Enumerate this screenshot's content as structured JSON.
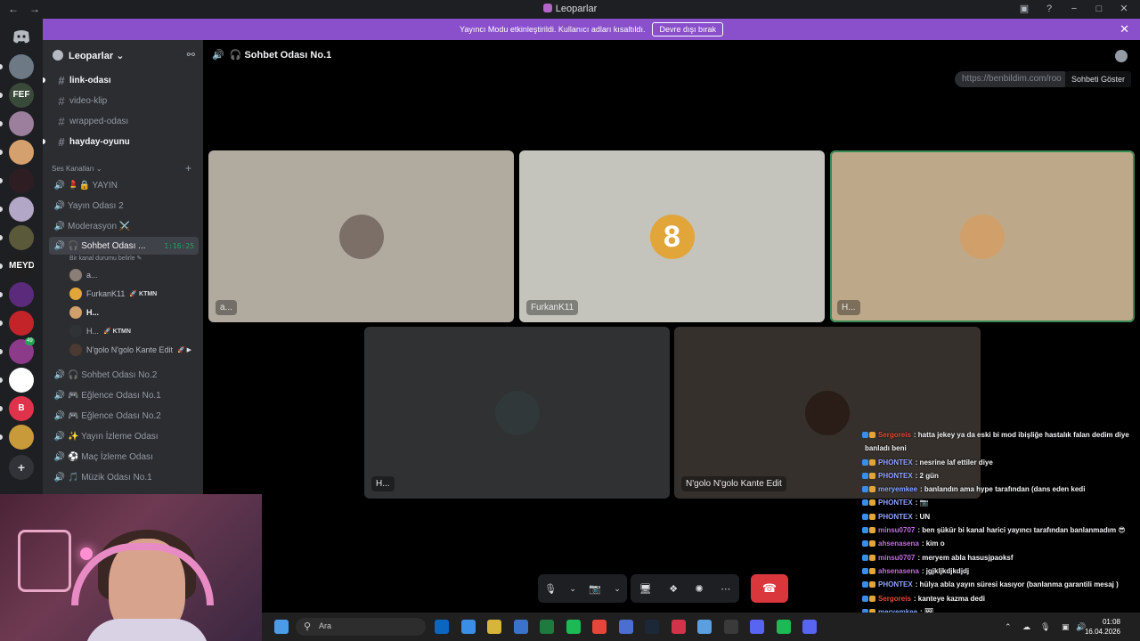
{
  "window": {
    "title": "Leoparlar",
    "controls": [
      "−",
      "□",
      "✕"
    ],
    "left_icons": [
      "←",
      "→"
    ]
  },
  "banner": {
    "message": "Yayıncı Modu etkinleştirildi. Kullanıcı adları kısaltıldı.",
    "button": "Devre dışı bırak",
    "color": "#8a4fcb"
  },
  "servers": [
    {
      "icon": "discord-home-icon",
      "label": ""
    },
    {
      "label": "",
      "color": "#6d7a86"
    },
    {
      "label": "FEF",
      "color": "#3a4a3a"
    },
    {
      "label": "",
      "color": "#9b7f9c"
    },
    {
      "label": "",
      "color": "#d4a16e"
    },
    {
      "label": "",
      "color": "#2e1e24"
    },
    {
      "label": "",
      "color": "#b3a7c8"
    },
    {
      "label": "",
      "color": "#5a5a3a"
    },
    {
      "label": "MEYDAN",
      "color": "#1f1f1f"
    },
    {
      "label": "",
      "color": "#5b2a7a"
    },
    {
      "label": "",
      "color": "#c2242a"
    },
    {
      "label": "",
      "color": "#8c3a8a",
      "badge": "49"
    },
    {
      "label": "",
      "color": "#ffffff"
    },
    {
      "label": "B",
      "color": "#e0334b"
    },
    {
      "label": "",
      "color": "#c99a3a"
    }
  ],
  "guild": {
    "name": "Leoparlar",
    "chevron": "⌄"
  },
  "text_channels": [
    {
      "name": "link-odası",
      "bold": true
    },
    {
      "name": "video-klip",
      "bold": false
    },
    {
      "name": "wrapped-odası",
      "bold": false
    },
    {
      "name": "hayday-oyunu",
      "bold": true
    }
  ],
  "voice_category": "Ses Kanalları",
  "voice_channels_top": [
    {
      "name": "💄🔒 YAYIN"
    },
    {
      "name": "Yayın Odası 2"
    },
    {
      "name": "Moderasyon ⚔️"
    }
  ],
  "active_channel": {
    "name": "🎧 Sohbet Odası ...",
    "timer": "1:16:25",
    "status": "Bir kanal durumu belirle ✎"
  },
  "members": [
    {
      "name": "a...",
      "color": "#8a7e76",
      "tag": ""
    },
    {
      "name": "FurkanK11",
      "color": "#e2a53a",
      "tag": "🚀 KTMN"
    },
    {
      "name": "H...",
      "color": "#d1a06a",
      "tag": "",
      "bold": true
    },
    {
      "name": "H...",
      "color": "#2f3336",
      "tag": "🚀 KTMN"
    },
    {
      "name": "N'golo N'golo Kante Edit",
      "color": "#4a3a32",
      "tag": "🚀 ▶"
    }
  ],
  "voice_channels_bottom": [
    {
      "name": "🎧 Sohbet Odası No.2"
    },
    {
      "name": "🎮 Eğlence Odası No.1"
    },
    {
      "name": "🎮 Eğlence Odası No.2"
    },
    {
      "name": "✨ Yayın İzleme Odası"
    },
    {
      "name": "⚽ Maç İzleme Odası"
    },
    {
      "name": "🎵 Müzik Odası No.1"
    }
  ],
  "voice_header": "🎧 Sohbet Odası No.1",
  "url_pill": "https://benbildim.com/roo",
  "tooltip": "Sohbeti Göster",
  "tiles": [
    {
      "name": "a...",
      "bg": "#b1aa9f",
      "avatar": "#7b6f68"
    },
    {
      "name": "FurkanK11",
      "bg": "#c4c3bc",
      "avatar": "#e2a53a",
      "avatar_text": "8"
    },
    {
      "name": "H...",
      "bg": "#bda98a",
      "avatar": "#d1a06a",
      "speaking": true
    },
    {
      "name": "H...",
      "bg": "#2f3132",
      "avatar": "#30383a"
    },
    {
      "name": "N'golo N'golo Kante Edit",
      "bg": "#35302c",
      "avatar": "#2a1d17"
    }
  ],
  "controls": {
    "mic": "🎙",
    "camera": "📷",
    "screen": "🖥",
    "activities": "❖",
    "soundboard": "✺",
    "more": "⋯",
    "hangup": "☎"
  },
  "chat": [
    {
      "user": "Sergoreis",
      "ucolor": "#e24b3a",
      "text": ": hatta jekey ya da eski bi mod ibişliğe hastalık falan dedim diye"
    },
    {
      "user": "",
      "ucolor": "#ffffff",
      "text": "banladı beni"
    },
    {
      "user": "PHONTEX",
      "ucolor": "#8ea3ff",
      "text": ": nesrine laf ettiler diye"
    },
    {
      "user": "PHONTEX",
      "ucolor": "#8ea3ff",
      "text": ": 2 gün"
    },
    {
      "user": "meryemkee",
      "ucolor": "#7fa8ff",
      "text": ": banlandın ama hype tarafından (dans eden kedi"
    },
    {
      "user": "PHONTEX",
      "ucolor": "#8ea3ff",
      "text": ": 📷"
    },
    {
      "user": "PHONTEX",
      "ucolor": "#8ea3ff",
      "text": ": UN"
    },
    {
      "user": "minsu0707",
      "ucolor": "#c06ee0",
      "text": ": ben şükür bi kanal harici yayıncı tarafından banlanmadım 😎"
    },
    {
      "user": "ahsenasena",
      "ucolor": "#c06ee0",
      "text": ": kim o"
    },
    {
      "user": "minsu0707",
      "ucolor": "#c06ee0",
      "text": ": meryem abla hasusjpaoksf"
    },
    {
      "user": "ahsenasena",
      "ucolor": "#c06ee0",
      "text": ": jgjkljkdjkdjdj"
    },
    {
      "user": "PHONTEX",
      "ucolor": "#8ea3ff",
      "text": ": hülya abla yayın süresi kasıyor (banlanma garantili mesaj )"
    },
    {
      "user": "Sergoreis",
      "ucolor": "#e24b3a",
      "text": ": kanteye kazma dedi"
    },
    {
      "user": "meryemkee",
      "ucolor": "#7fa8ff",
      "text": ": 🖼"
    },
    {
      "user": "minsu0707",
      "ucolor": "#c06ee0",
      "text": ": 😮"
    },
    {
      "user": "Sergoreis",
      "ucolor": "#e24b3a",
      "text": ": 🖼"
    }
  ],
  "taskbar": {
    "search_placeholder": "Ara",
    "time": "01:08",
    "date": "16.04.2026",
    "apps": [
      "#0b66c2",
      "#3a8ee6",
      "#d6b53a",
      "#3a73c9",
      "#1e7a3e",
      "#1db954",
      "#e6463a",
      "#4b6fd1",
      "#1b2838",
      "#d1344a",
      "#5a9fe0",
      "#3a3a3a",
      "#5865f2",
      "#1db954",
      "#5865f2"
    ]
  }
}
